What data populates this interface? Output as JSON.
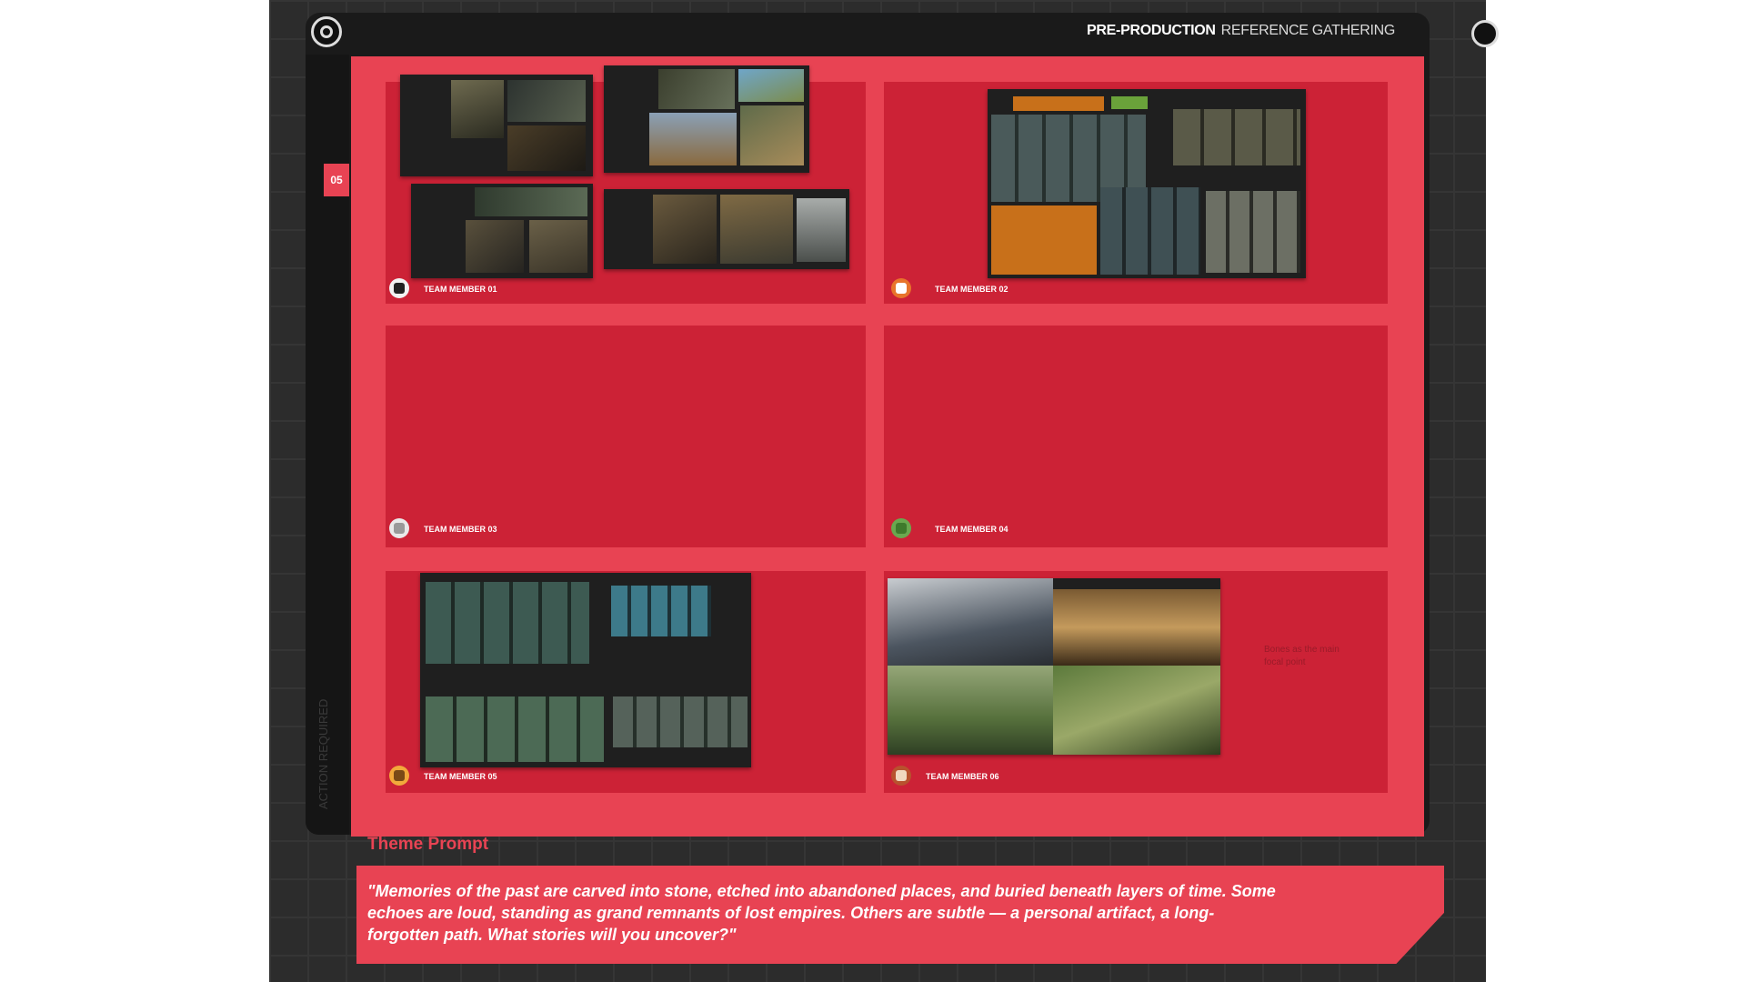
{
  "header": {
    "title_bold": "PRE-PRODUCTION",
    "title_light": "REFERENCE GATHERING"
  },
  "step_badge": "05",
  "side_label": "ACTION REQUIRED",
  "panels": [
    {
      "label": "TEAM MEMBER 01",
      "avatar_icon": "penguin-icon",
      "avatar_color": "#f2f2f2"
    },
    {
      "label": "TEAM MEMBER 02",
      "avatar_icon": "fox-icon",
      "avatar_color": "#e8742b"
    },
    {
      "label": "TEAM MEMBER 03",
      "avatar_icon": "mouse-icon",
      "avatar_color": "#e9e9e9"
    },
    {
      "label": "TEAM MEMBER 04",
      "avatar_icon": "frog-icon",
      "avatar_color": "#6aa84f"
    },
    {
      "label": "TEAM MEMBER 05",
      "avatar_icon": "lion-icon",
      "avatar_color": "#f2a93b"
    },
    {
      "label": "TEAM MEMBER 06",
      "avatar_icon": "owl-icon",
      "avatar_color": "#b8522e"
    }
  ],
  "annotation": "Bones as the main focal point",
  "theme": {
    "title": "Theme Prompt",
    "text": "\"Memories of the past are carved into stone, etched into abandoned places, and buried beneath layers of time. Some echoes are loud, standing as grand remnants of lost empires. Others are subtle — a personal artifact, a long-forgotten path. What stories will you uncover?\""
  },
  "colors": {
    "board": "#e84353",
    "panel": "#cc2236",
    "frame": "#1a1a1a",
    "canvas": "#2c2c2c",
    "sticky_note": "#c8701a",
    "tag_green": "#6aa23a"
  }
}
